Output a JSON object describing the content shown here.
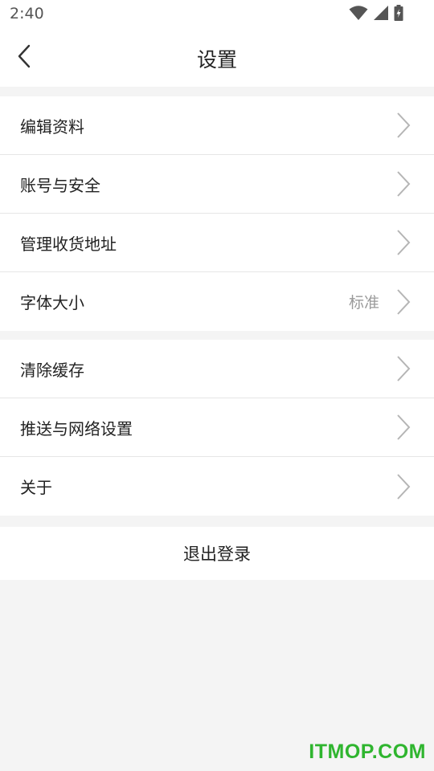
{
  "status_bar": {
    "time": "2:40",
    "icons": [
      "wifi-icon",
      "cell-signal-icon",
      "battery-charging-icon"
    ]
  },
  "header": {
    "title": "设置",
    "back_icon": "chevron-left-icon"
  },
  "groups": [
    {
      "items": [
        {
          "label": "编辑资料",
          "value": ""
        },
        {
          "label": "账号与安全",
          "value": ""
        },
        {
          "label": "管理收货地址",
          "value": ""
        },
        {
          "label": "字体大小",
          "value": "标准"
        }
      ]
    },
    {
      "items": [
        {
          "label": "清除缓存",
          "value": ""
        },
        {
          "label": "推送与网络设置",
          "value": ""
        },
        {
          "label": "关于",
          "value": ""
        }
      ]
    }
  ],
  "logout_label": "退出登录",
  "watermark": "ITMOP.COM",
  "colors": {
    "background": "#f4f4f4",
    "card": "#ffffff",
    "text": "#222222",
    "secondary_text": "#9a9a9a",
    "chevron": "#b5b5b5",
    "watermark": "#2fb52f"
  }
}
